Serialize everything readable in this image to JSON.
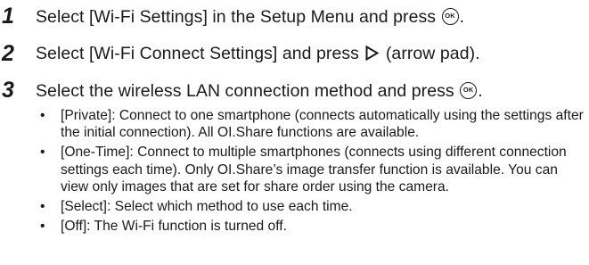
{
  "steps": [
    {
      "number": "1",
      "text_before": "Select [Wi-Fi Settings] in the Setup Menu and press ",
      "icon": "ok-button-icon",
      "icon_label": "OK",
      "text_after": "."
    },
    {
      "number": "2",
      "text_before": "Select [Wi-Fi Connect Settings] and press ",
      "icon": "arrow-right-icon",
      "text_after": " (arrow pad)."
    },
    {
      "number": "3",
      "text_before": "Select the wireless LAN connection method and press ",
      "icon": "ok-button-icon",
      "icon_label": "OK",
      "text_after": "."
    }
  ],
  "bullets": [
    {
      "marker": "•",
      "text": "[Private]: Connect to one smartphone (connects automatically using the settings after the initial connection). All OI.Share functions are available."
    },
    {
      "marker": "•",
      "text": "[One-Time]: Connect to multiple smartphones (connects using different connection settings each time). Only OI.Share’s image transfer function is available. You can view only images that are set for share order using the camera."
    },
    {
      "marker": "•",
      "text": "[Select]: Select which method to use each time."
    },
    {
      "marker": "•",
      "text": "[Off]: The Wi-Fi function is turned off."
    }
  ]
}
